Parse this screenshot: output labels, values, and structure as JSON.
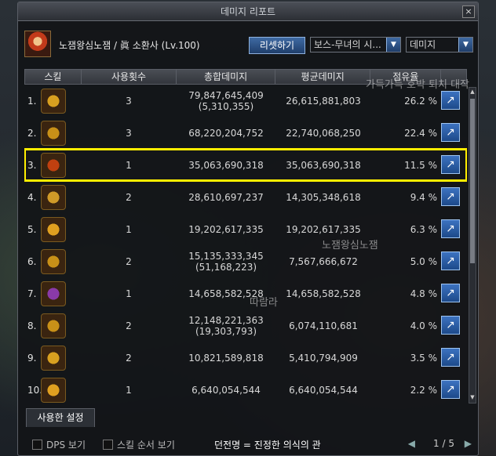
{
  "window": {
    "title": "데미지 리포트",
    "close_icon": "×"
  },
  "header": {
    "character": "노잼왕심노잼 / 眞 소환사 (Lv.100)",
    "reset_label": "리셋하기",
    "dungeon_select": "보스-무녀의 시...",
    "metric_select": "데미지"
  },
  "columns": [
    "스킬",
    "사용횟수",
    "총합데미지",
    "평균데미지",
    "점유율",
    ""
  ],
  "rows": [
    {
      "num": "1.",
      "uses": "3",
      "total": "79,847,645,409",
      "sub": "(5,310,355)",
      "avg": "26,615,881,803",
      "pct": "26.2 %",
      "color": "#d8a020"
    },
    {
      "num": "2.",
      "uses": "3",
      "total": "68,220,204,752",
      "sub": "",
      "avg": "22,740,068,250",
      "pct": "22.4 %",
      "color": "#c89018"
    },
    {
      "num": "3.",
      "uses": "1",
      "total": "35,063,690,318",
      "sub": "",
      "avg": "35,063,690,318",
      "pct": "11.5 %",
      "color": "#c04010"
    },
    {
      "num": "4.",
      "uses": "2",
      "total": "28,610,697,237",
      "sub": "",
      "avg": "14,305,348,618",
      "pct": "9.4 %",
      "color": "#d09a28"
    },
    {
      "num": "5.",
      "uses": "1",
      "total": "19,202,617,335",
      "sub": "",
      "avg": "19,202,617,335",
      "pct": "6.3 %",
      "color": "#e0a020"
    },
    {
      "num": "6.",
      "uses": "2",
      "total": "15,135,333,345",
      "sub": "(51,168,223)",
      "avg": "7,567,666,672",
      "pct": "5.0 %",
      "color": "#c89018"
    },
    {
      "num": "7.",
      "uses": "1",
      "total": "14,658,582,528",
      "sub": "",
      "avg": "14,658,582,528",
      "pct": "4.8 %",
      "color": "#8a3aa8"
    },
    {
      "num": "8.",
      "uses": "2",
      "total": "12,148,221,363",
      "sub": "(19,303,793)",
      "avg": "6,074,110,681",
      "pct": "4.0 %",
      "color": "#c89018"
    },
    {
      "num": "9.",
      "uses": "2",
      "total": "10,821,589,818",
      "sub": "",
      "avg": "5,410,794,909",
      "pct": "3.5 %",
      "color": "#d8a020"
    },
    {
      "num": "10.",
      "uses": "1",
      "total": "6,640,054,544",
      "sub": "",
      "avg": "6,640,054,544",
      "pct": "2.2 %",
      "color": "#e0a020"
    }
  ],
  "tab_label": "사용한 설정",
  "footer": {
    "dps_label": "DPS 보기",
    "skill_order_label": "스킬 순서 보기",
    "title_text": "던전명 = 진정한 의식의 관",
    "page": "1 / 5"
  },
  "overlay": {
    "text1": "가득가득 호박 퇴치 대작",
    "text2": "노잼왕심노잼",
    "text3": "따람라"
  }
}
